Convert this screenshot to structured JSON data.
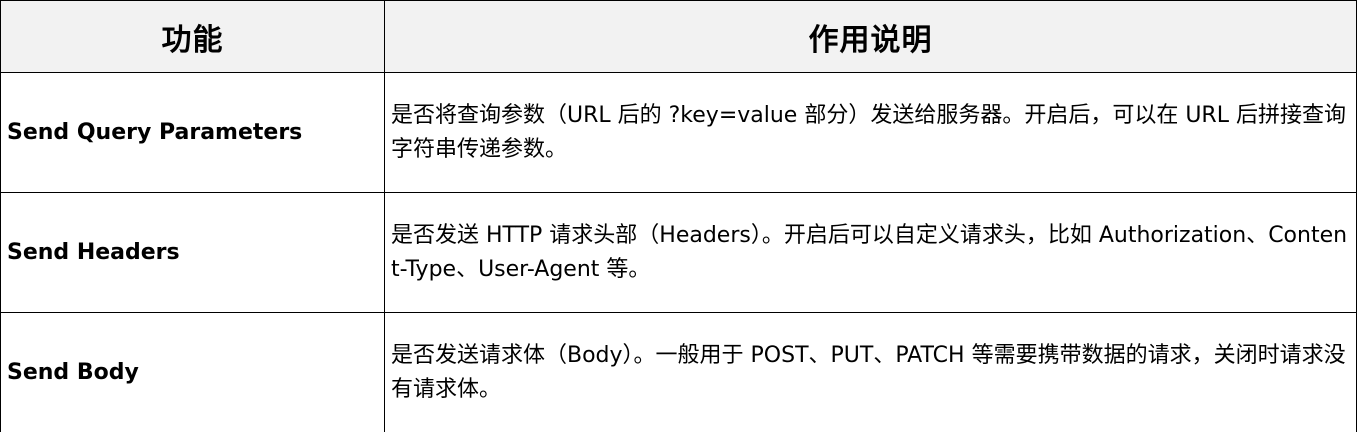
{
  "table": {
    "headers": [
      "功能",
      "作用说明"
    ],
    "rows": [
      {
        "feature": "Send Query Parameters",
        "description": "是否将查询参数（URL 后的 ?key=value 部分）发送给服务器。开启后，可以在 URL 后拼接查询字符串传递参数。"
      },
      {
        "feature": "Send Headers",
        "description": "是否发送 HTTP 请求头部（Headers）。开启后可以自定义请求头，比如 Authorization、Content-Type、User-Agent 等。"
      },
      {
        "feature": "Send Body",
        "description": "是否发送请求体（Body）。一般用于 POST、PUT、PATCH 等需要携带数据的请求，关闭时请求没有请求体。"
      }
    ]
  },
  "colors": {
    "header_bg": "#f2f2f2",
    "border": "#000000",
    "text": "#000000"
  }
}
